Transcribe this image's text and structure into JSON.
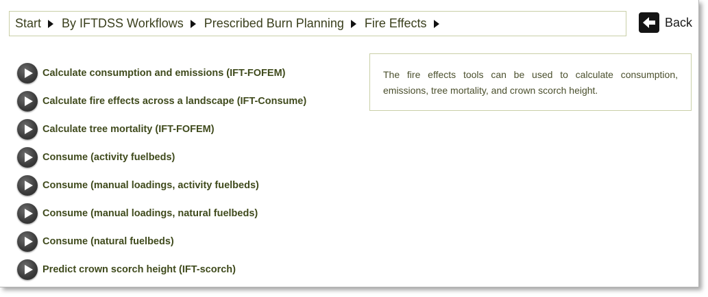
{
  "breadcrumb": {
    "items": [
      {
        "label": "Start"
      },
      {
        "label": "By IFTDSS Workflows"
      },
      {
        "label": "Prescribed Burn Planning"
      },
      {
        "label": "Fire Effects"
      }
    ]
  },
  "back": {
    "label": "Back",
    "icon": "back-arrow-icon"
  },
  "links": [
    {
      "label": "Calculate consumption and emissions (IFT-FOFEM)"
    },
    {
      "label": "Calculate fire effects across a landscape (IFT-Consume)"
    },
    {
      "label": "Calculate tree mortality (IFT-FOFEM)"
    },
    {
      "label": "Consume (activity fuelbeds)"
    },
    {
      "label": "Consume (manual loadings, activity fuelbeds)"
    },
    {
      "label": "Consume (manual loadings, natural fuelbeds)"
    },
    {
      "label": "Consume (natural fuelbeds)"
    },
    {
      "label": "Predict crown scorch height (IFT-scorch)"
    }
  ],
  "info": {
    "text": "The fire effects tools can be used to calculate consumption, emissions, tree mortality, and crown scorch height."
  },
  "colors": {
    "border": "#c9cfa6",
    "link_text": "#3f4a1c",
    "play_button": "#3d3d3d"
  }
}
